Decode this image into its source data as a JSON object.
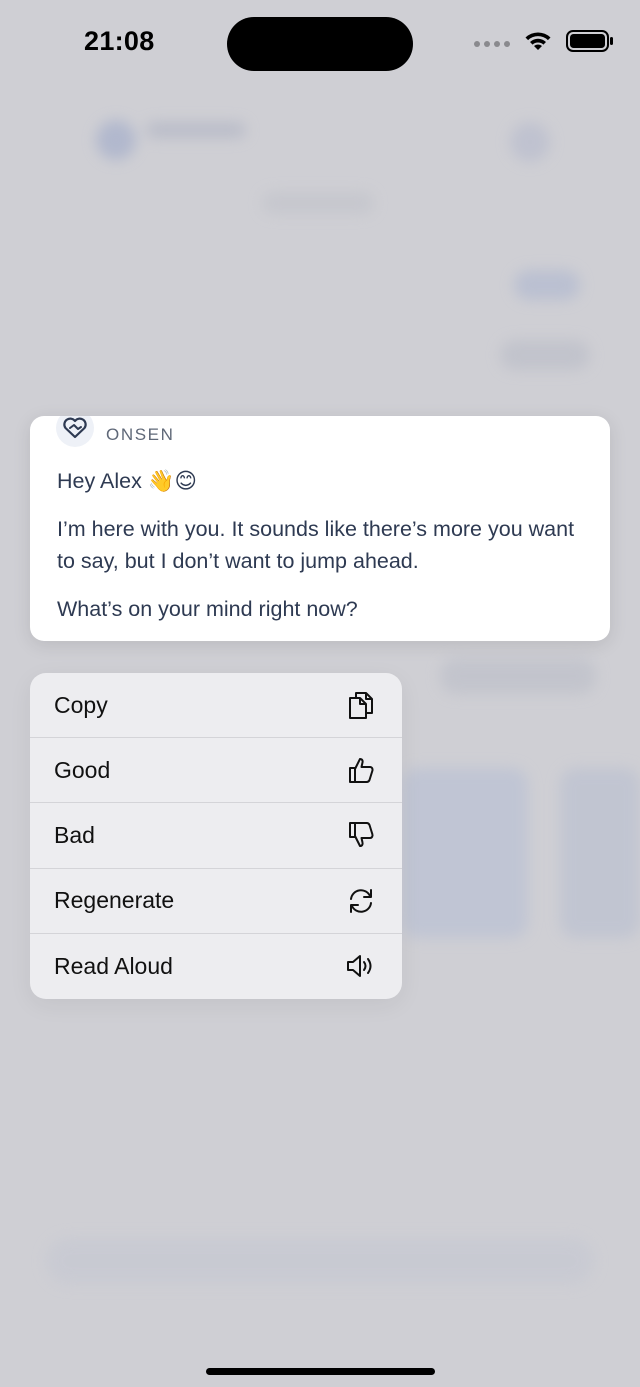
{
  "status_bar": {
    "time": "21:08",
    "icons": [
      "cellular-dots-icon",
      "wifi-icon",
      "battery-icon"
    ]
  },
  "message": {
    "sender": "ONSEN",
    "sender_icon": "heart-handshake-icon",
    "greeting": "Hey Alex 👋😊",
    "body": "I’m here with you. It sounds like there’s more you want to say, but I don’t want to jump ahead.",
    "question": "What’s on your mind right now?"
  },
  "context_menu": {
    "items": [
      {
        "label": "Copy",
        "icon": "copy-icon"
      },
      {
        "label": "Good",
        "icon": "thumbs-up-icon"
      },
      {
        "label": "Bad",
        "icon": "thumbs-down-icon"
      },
      {
        "label": "Regenerate",
        "icon": "regenerate-icon"
      },
      {
        "label": "Read Aloud",
        "icon": "speaker-icon"
      }
    ]
  },
  "colors": {
    "background": "#cfcfd4",
    "card": "#ffffff",
    "menu": "#ededf0",
    "message_text": "#2e3a52",
    "sender_text": "#5f6878"
  }
}
